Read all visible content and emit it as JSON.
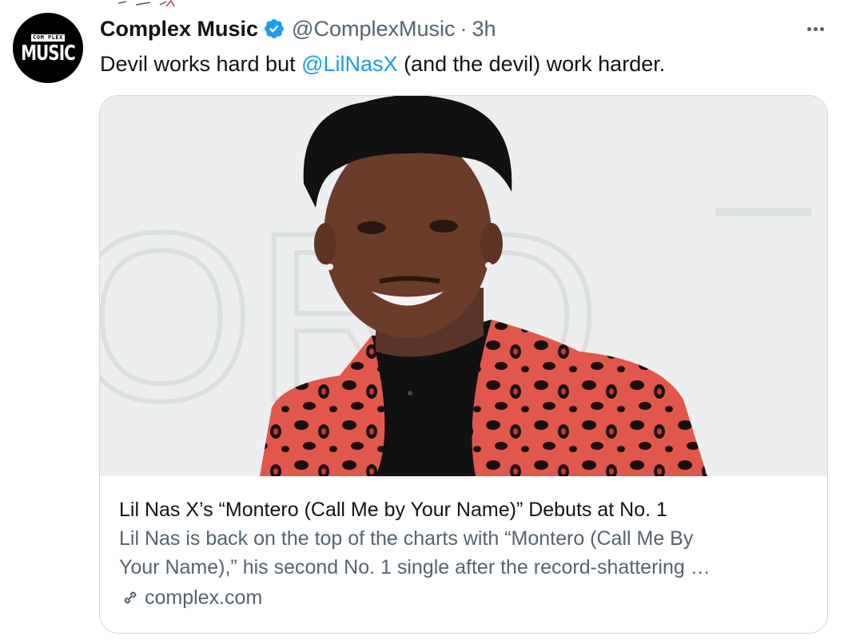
{
  "tweet": {
    "author_name": "Complex Music",
    "handle": "@ComplexMusic",
    "separator": "·",
    "time": "3h",
    "text_before": "Devil works hard but ",
    "mention": "@LilNasX",
    "text_after": " (and the devil) work harder.",
    "avatar_small": "COM PLEX",
    "avatar_big": "MUSIC",
    "icons": [
      "verified-badge-icon",
      "more-options-icon",
      "link-icon"
    ]
  },
  "card": {
    "image_alt": "Lil Nas X smiling in a red leopard-print jacket",
    "backdrop_letters": "ORD",
    "title": "Lil Nas X’s “Montero (Call Me by Your Name)” Debuts at No. 1",
    "desc_line1": "Lil Nas is back on the top of the charts with “Montero (Call Me By",
    "desc_line2": "Your Name),” his second No. 1 single after the record-shattering …",
    "domain": "complex.com"
  },
  "colors": {
    "accent": "#1d9bf0",
    "secondary_text": "#536471",
    "border": "#cfd9de",
    "jacket": "#e2574c"
  }
}
